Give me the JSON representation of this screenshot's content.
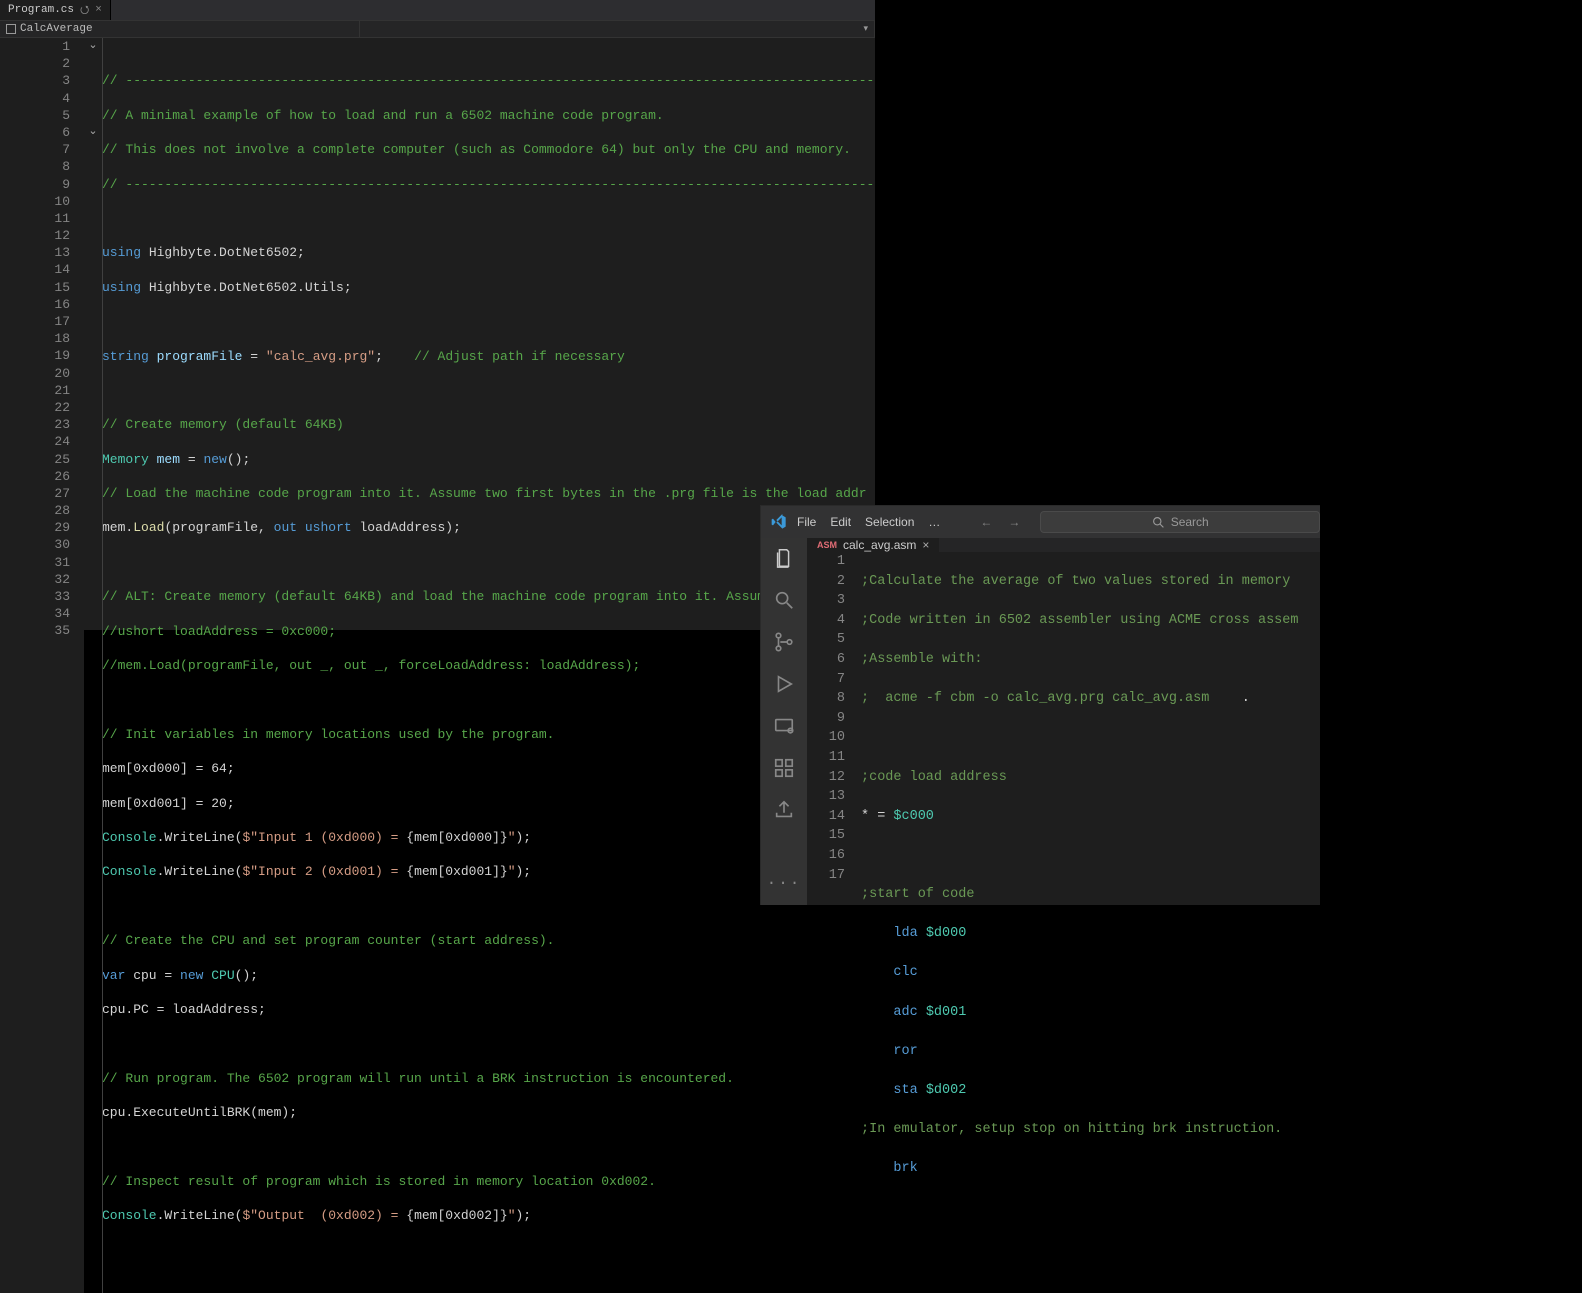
{
  "left": {
    "tab": {
      "title": "Program.cs",
      "pin_glyph": "⭯",
      "close_glyph": "×"
    },
    "navbar": {
      "namespace": "CalcAverage"
    },
    "line_start": 1,
    "line_end": 35,
    "fold_lines": [
      1,
      6
    ],
    "code": {
      "l1": "// ------------------------------------------------------------------------------------------------",
      "l2": "// A minimal example of how to load and run a 6502 machine code program.",
      "l3": "// This does not involve a complete computer (such as Commodore 64) but only the CPU and memory.",
      "l4": "// ------------------------------------------------------------------------------------------------",
      "l6a": "using",
      "l6b": "Highbyte.DotNet6502;",
      "l7a": "using",
      "l7b": "Highbyte.DotNet6502.Utils;",
      "l9a": "string",
      "l9b": "programFile",
      "l9c": "=",
      "l9d": "\"calc_avg.prg\"",
      "l9e": ";",
      "l9f": "// Adjust path if necessary",
      "l11": "// Create memory (default 64KB)",
      "l12a": "Memory",
      "l12b": "mem",
      "l12c": "= ",
      "l12d": "new",
      "l12e": "();",
      "l13": "// Load the machine code program into it. Assume two first bytes in the .prg file is the load addr",
      "l14a": "mem.",
      "l14b": "Load",
      "l14c": "(programFile, ",
      "l14d": "out ushort",
      "l14e": " loadAddress);",
      "l16": "// ALT: Create memory (default 64KB) and load the machine code program into it. Assume the .prg fi",
      "l17": "//ushort loadAddress = 0xc000;",
      "l18": "//mem.Load(programFile, out _, out _, forceLoadAddress: loadAddress);",
      "l20": "// Init variables in memory locations used by the program.",
      "l21": "mem[0xd000] = 64;",
      "l22": "mem[0xd001] = 20;",
      "l23a": "Console",
      "l23b": ".WriteLine(",
      "l23c": "$\"Input 1 (0xd000) = ",
      "l23d": "{mem[0xd000]}",
      "l23e": "\"",
      "l23f": ");",
      "l24a": "Console",
      "l24b": ".WriteLine(",
      "l24c": "$\"Input 2 (0xd001) = ",
      "l24d": "{mem[0xd001]}",
      "l24e": "\"",
      "l24f": ");",
      "l26": "// Create the CPU and set program counter (start address).",
      "l27a": "var",
      "l27b": " cpu = ",
      "l27c": "new",
      "l27d": " CPU",
      "l27e": "();",
      "l28": "cpu.PC = loadAddress;",
      "l30": "// Run program. The 6502 program will run until a BRK instruction is encountered.",
      "l31": "cpu.ExecuteUntilBRK(mem);",
      "l33": "// Inspect result of program which is stored in memory location 0xd002.",
      "l34a": "Console",
      "l34b": ".WriteLine(",
      "l34c": "$\"Output  (0xd002) = ",
      "l34d": "{mem[0xd002]}",
      "l34e": "\"",
      "l34f": ");"
    }
  },
  "right": {
    "menu": {
      "file": "File",
      "edit": "Edit",
      "selection": "Selection",
      "more": "…"
    },
    "nav": {
      "back": "←",
      "fwd": "→"
    },
    "search_placeholder": "Search",
    "tab": {
      "badge": "ASM",
      "title": "calc_avg.asm",
      "close_glyph": "×"
    },
    "line_start": 1,
    "line_end": 17,
    "code": {
      "l1": ";Calculate the average of two values stored in memory",
      "l2": ";Code written in 6502 assembler using ACME cross assem",
      "l3": ";Assemble with:",
      "l4a": ";  acme -f cbm -o calc_avg.prg calc_avg.asm",
      "l4b": "    .",
      "l6": ";code load address",
      "l7a": "* = ",
      "l7b": "$c000",
      "l9": ";start of code",
      "l10a": "lda ",
      "l10b": "$d000",
      "l11": "clc",
      "l12a": "adc ",
      "l12b": "$d001",
      "l13": "ror",
      "l14a": "sta ",
      "l14b": "$d002",
      "l15": ";In emulator, setup stop on hitting brk instruction.",
      "l16": "brk"
    }
  }
}
